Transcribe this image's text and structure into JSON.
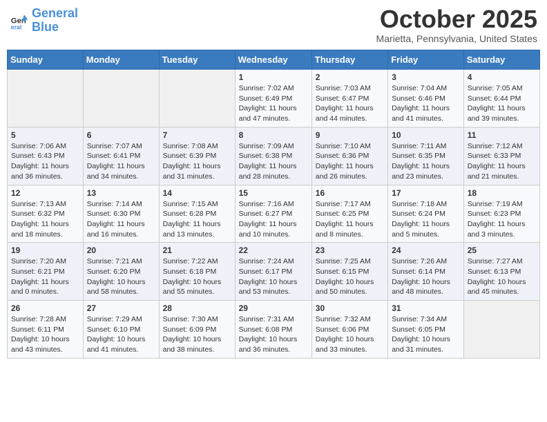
{
  "header": {
    "logo_line1": "General",
    "logo_line2": "Blue",
    "month": "October 2025",
    "location": "Marietta, Pennsylvania, United States"
  },
  "days_of_week": [
    "Sunday",
    "Monday",
    "Tuesday",
    "Wednesday",
    "Thursday",
    "Friday",
    "Saturday"
  ],
  "weeks": [
    [
      {
        "num": "",
        "info": ""
      },
      {
        "num": "",
        "info": ""
      },
      {
        "num": "",
        "info": ""
      },
      {
        "num": "1",
        "info": "Sunrise: 7:02 AM\nSunset: 6:49 PM\nDaylight: 11 hours and 47 minutes."
      },
      {
        "num": "2",
        "info": "Sunrise: 7:03 AM\nSunset: 6:47 PM\nDaylight: 11 hours and 44 minutes."
      },
      {
        "num": "3",
        "info": "Sunrise: 7:04 AM\nSunset: 6:46 PM\nDaylight: 11 hours and 41 minutes."
      },
      {
        "num": "4",
        "info": "Sunrise: 7:05 AM\nSunset: 6:44 PM\nDaylight: 11 hours and 39 minutes."
      }
    ],
    [
      {
        "num": "5",
        "info": "Sunrise: 7:06 AM\nSunset: 6:43 PM\nDaylight: 11 hours and 36 minutes."
      },
      {
        "num": "6",
        "info": "Sunrise: 7:07 AM\nSunset: 6:41 PM\nDaylight: 11 hours and 34 minutes."
      },
      {
        "num": "7",
        "info": "Sunrise: 7:08 AM\nSunset: 6:39 PM\nDaylight: 11 hours and 31 minutes."
      },
      {
        "num": "8",
        "info": "Sunrise: 7:09 AM\nSunset: 6:38 PM\nDaylight: 11 hours and 28 minutes."
      },
      {
        "num": "9",
        "info": "Sunrise: 7:10 AM\nSunset: 6:36 PM\nDaylight: 11 hours and 26 minutes."
      },
      {
        "num": "10",
        "info": "Sunrise: 7:11 AM\nSunset: 6:35 PM\nDaylight: 11 hours and 23 minutes."
      },
      {
        "num": "11",
        "info": "Sunrise: 7:12 AM\nSunset: 6:33 PM\nDaylight: 11 hours and 21 minutes."
      }
    ],
    [
      {
        "num": "12",
        "info": "Sunrise: 7:13 AM\nSunset: 6:32 PM\nDaylight: 11 hours and 18 minutes."
      },
      {
        "num": "13",
        "info": "Sunrise: 7:14 AM\nSunset: 6:30 PM\nDaylight: 11 hours and 16 minutes."
      },
      {
        "num": "14",
        "info": "Sunrise: 7:15 AM\nSunset: 6:28 PM\nDaylight: 11 hours and 13 minutes."
      },
      {
        "num": "15",
        "info": "Sunrise: 7:16 AM\nSunset: 6:27 PM\nDaylight: 11 hours and 10 minutes."
      },
      {
        "num": "16",
        "info": "Sunrise: 7:17 AM\nSunset: 6:25 PM\nDaylight: 11 hours and 8 minutes."
      },
      {
        "num": "17",
        "info": "Sunrise: 7:18 AM\nSunset: 6:24 PM\nDaylight: 11 hours and 5 minutes."
      },
      {
        "num": "18",
        "info": "Sunrise: 7:19 AM\nSunset: 6:23 PM\nDaylight: 11 hours and 3 minutes."
      }
    ],
    [
      {
        "num": "19",
        "info": "Sunrise: 7:20 AM\nSunset: 6:21 PM\nDaylight: 11 hours and 0 minutes."
      },
      {
        "num": "20",
        "info": "Sunrise: 7:21 AM\nSunset: 6:20 PM\nDaylight: 10 hours and 58 minutes."
      },
      {
        "num": "21",
        "info": "Sunrise: 7:22 AM\nSunset: 6:18 PM\nDaylight: 10 hours and 55 minutes."
      },
      {
        "num": "22",
        "info": "Sunrise: 7:24 AM\nSunset: 6:17 PM\nDaylight: 10 hours and 53 minutes."
      },
      {
        "num": "23",
        "info": "Sunrise: 7:25 AM\nSunset: 6:15 PM\nDaylight: 10 hours and 50 minutes."
      },
      {
        "num": "24",
        "info": "Sunrise: 7:26 AM\nSunset: 6:14 PM\nDaylight: 10 hours and 48 minutes."
      },
      {
        "num": "25",
        "info": "Sunrise: 7:27 AM\nSunset: 6:13 PM\nDaylight: 10 hours and 45 minutes."
      }
    ],
    [
      {
        "num": "26",
        "info": "Sunrise: 7:28 AM\nSunset: 6:11 PM\nDaylight: 10 hours and 43 minutes."
      },
      {
        "num": "27",
        "info": "Sunrise: 7:29 AM\nSunset: 6:10 PM\nDaylight: 10 hours and 41 minutes."
      },
      {
        "num": "28",
        "info": "Sunrise: 7:30 AM\nSunset: 6:09 PM\nDaylight: 10 hours and 38 minutes."
      },
      {
        "num": "29",
        "info": "Sunrise: 7:31 AM\nSunset: 6:08 PM\nDaylight: 10 hours and 36 minutes."
      },
      {
        "num": "30",
        "info": "Sunrise: 7:32 AM\nSunset: 6:06 PM\nDaylight: 10 hours and 33 minutes."
      },
      {
        "num": "31",
        "info": "Sunrise: 7:34 AM\nSunset: 6:05 PM\nDaylight: 10 hours and 31 minutes."
      },
      {
        "num": "",
        "info": ""
      }
    ]
  ]
}
